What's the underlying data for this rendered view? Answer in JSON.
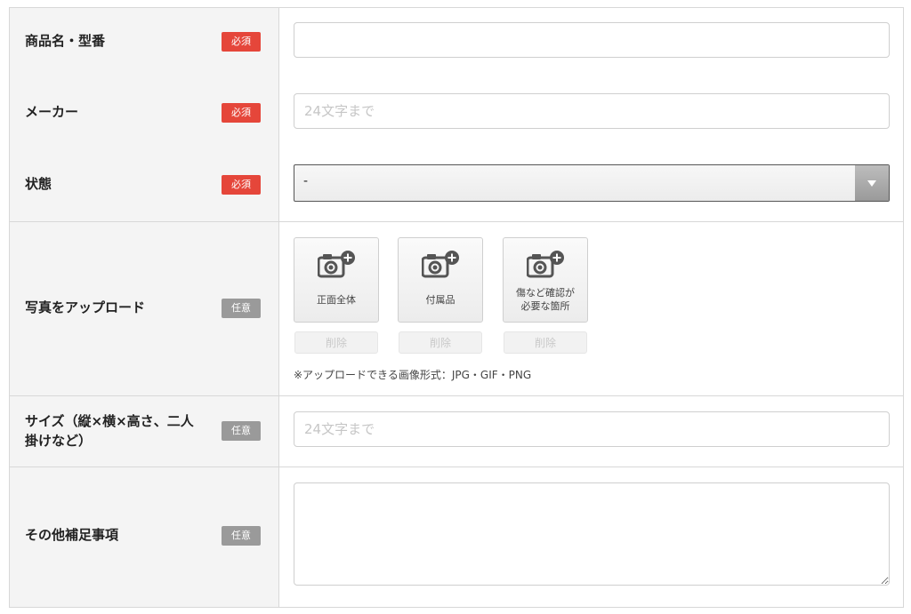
{
  "fields": {
    "product_name": {
      "label": "商品名・型番",
      "badge": "必須",
      "value": ""
    },
    "maker": {
      "label": "メーカー",
      "badge": "必須",
      "placeholder": "24文字まで"
    },
    "condition": {
      "label": "状態",
      "badge": "必須",
      "selected": "-"
    },
    "upload": {
      "label": "写真をアップロード",
      "badge": "任意",
      "slots": [
        {
          "caption": "正面全体",
          "delete_label": "削除"
        },
        {
          "caption": "付属品",
          "delete_label": "削除"
        },
        {
          "caption_line1": "傷など確認が",
          "caption_line2": "必要な箇所",
          "delete_label": "削除"
        }
      ],
      "note": "※アップロードできる画像形式：JPG・GIF・PNG"
    },
    "size": {
      "label_line1": "サイズ（縦×横×高さ、二人",
      "label_line2": "掛けなど）",
      "badge": "任意",
      "placeholder": "24文字まで"
    },
    "notes": {
      "label": "その他補足事項",
      "badge": "任意",
      "value": ""
    }
  },
  "colors": {
    "required": "#e5463a",
    "optional": "#9a9a9a",
    "label_bg": "#f4f4f4",
    "border": "#d8d8d8"
  },
  "icons": {
    "photo_slot": "camera-plus-icon",
    "select_arrow": "triangle-down-icon"
  }
}
